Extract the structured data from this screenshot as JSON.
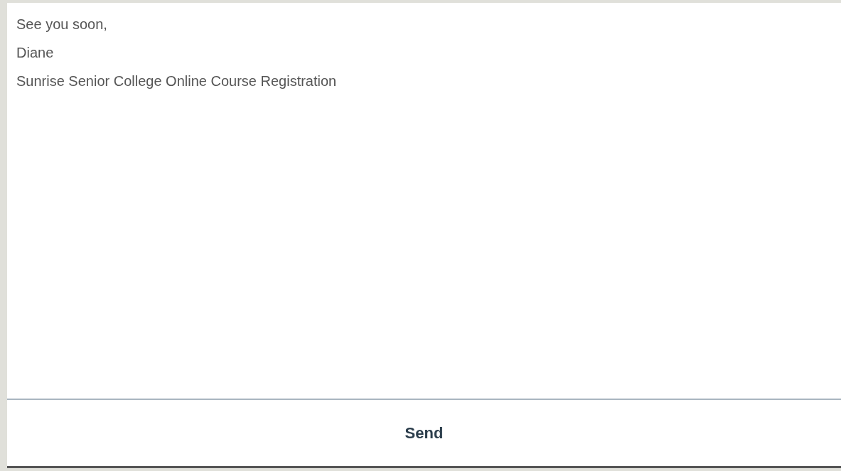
{
  "message": {
    "lines": [
      "See you soon,",
      "Diane",
      "Sunrise Senior College Online Course Registration"
    ]
  },
  "send_button": {
    "label": "Send"
  }
}
